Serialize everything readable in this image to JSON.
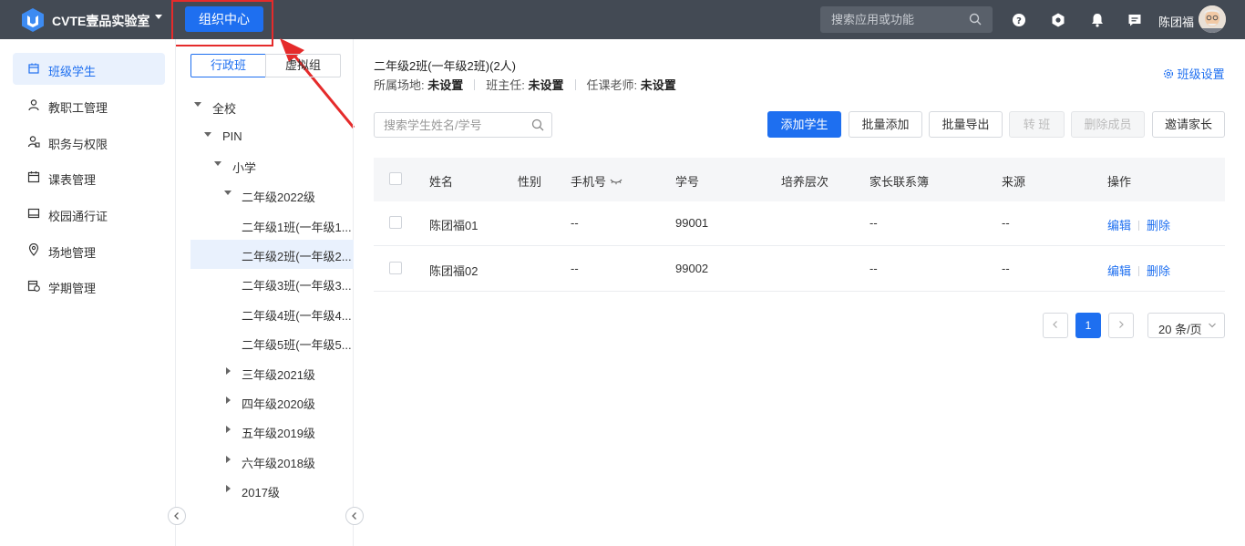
{
  "topbar": {
    "app_title": "CVTE壹品实验室",
    "org_center": "组织中心",
    "search_placeholder": "搜索应用或功能",
    "user_name": "陈团福"
  },
  "sidebar": {
    "items": [
      {
        "label": "班级学生",
        "icon": "class-icon",
        "active": true
      },
      {
        "label": "教职工管理",
        "icon": "person-icon"
      },
      {
        "label": "职务与权限",
        "icon": "role-icon"
      },
      {
        "label": "课表管理",
        "icon": "calendar-icon"
      },
      {
        "label": "校园通行证",
        "icon": "card-icon"
      },
      {
        "label": "场地管理",
        "icon": "location-icon"
      },
      {
        "label": "学期管理",
        "icon": "term-icon"
      }
    ]
  },
  "tree": {
    "tabs": [
      "行政班",
      "虚拟组"
    ],
    "nodes": [
      {
        "label": "全校"
      },
      {
        "label": "PIN"
      },
      {
        "label": "小学"
      },
      {
        "label": "二年级2022级"
      },
      {
        "label": "二年级1班(一年级1..."
      },
      {
        "label": "二年级2班(一年级2...",
        "active": true
      },
      {
        "label": "二年级3班(一年级3..."
      },
      {
        "label": "二年级4班(一年级4..."
      },
      {
        "label": "二年级5班(一年级5..."
      },
      {
        "label": "三年级2021级"
      },
      {
        "label": "四年级2020级"
      },
      {
        "label": "五年级2019级"
      },
      {
        "label": "六年级2018级"
      },
      {
        "label": "2017级"
      }
    ]
  },
  "main": {
    "class_title": "二年级2班(一年级2班)(2人)",
    "meta": {
      "venue_label": "所属场地:",
      "venue_value": "未设置",
      "head_teacher_label": "班主任:",
      "head_teacher_value": "未设置",
      "teacher_label": "任课老师:",
      "teacher_value": "未设置"
    },
    "settings_label": "班级设置",
    "search_placeholder": "搜索学生姓名/学号",
    "buttons": {
      "add_student": "添加学生",
      "batch_add": "批量添加",
      "batch_export": "批量导出",
      "transfer": "转 班",
      "delete_member": "删除成员",
      "invite_parent": "邀请家长"
    },
    "table": {
      "headers": [
        "姓名",
        "性别",
        "手机号",
        "学号",
        "培养层次",
        "家长联系簿",
        "来源",
        "操作"
      ],
      "rows": [
        {
          "name": "陈团福01",
          "gender": "",
          "phone": "--",
          "id": "99001",
          "level": "",
          "contact": "--",
          "source": "--",
          "edit": "编辑",
          "delete": "删除"
        },
        {
          "name": "陈团福02",
          "gender": "",
          "phone": "--",
          "id": "99002",
          "level": "",
          "contact": "--",
          "source": "--",
          "edit": "编辑",
          "delete": "删除"
        }
      ]
    },
    "pager": {
      "current_page": "1",
      "page_size": "20 条/页"
    }
  },
  "colors": {
    "topbar": "#434a54",
    "primary": "#1e6ff0",
    "highlight": "#e52b2b"
  }
}
